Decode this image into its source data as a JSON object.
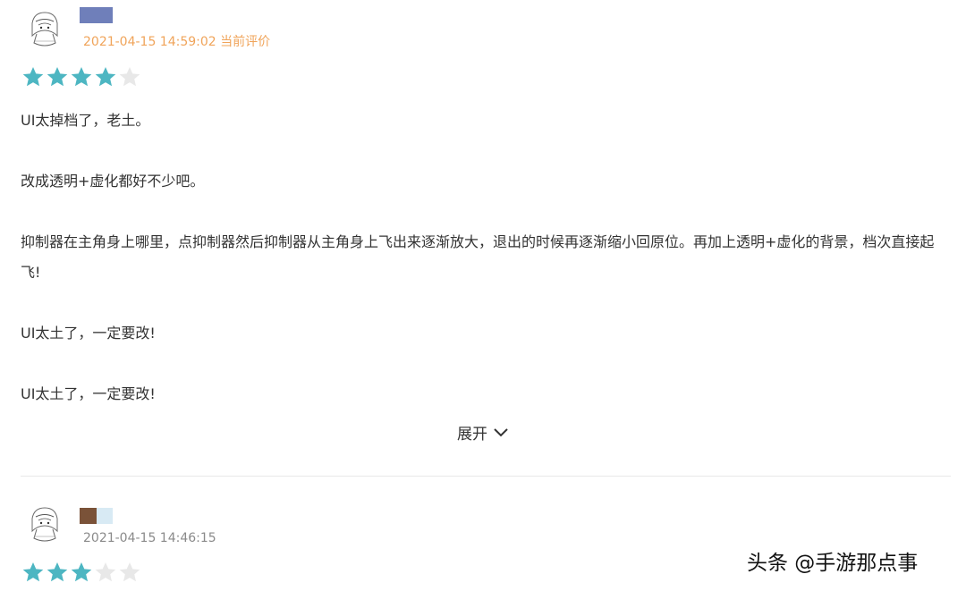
{
  "reviews": [
    {
      "meta": "2021-04-15 14:59:02 当前评价",
      "rating": 4,
      "max_rating": 5,
      "paragraphs": [
        "UI太掉档了，老土。",
        "改成透明+虚化都好不少吧。",
        "抑制器在主角身上哪里，点抑制器然后抑制器从主角身上飞出来逐渐放大，退出的时候再逐渐缩小回原位。再加上透明+虚化的背景，档次直接起飞!",
        "UI太土了，一定要改!",
        "UI太土了，一定要改!"
      ],
      "expand_label": "展开",
      "username_colors": [
        "#6f7fba"
      ]
    },
    {
      "meta": "2021-04-15 14:46:15",
      "rating": 3,
      "max_rating": 5,
      "username_colors": [
        "#7a5238",
        "#d8eaf4"
      ]
    }
  ],
  "watermark": "头条 @手游那点事",
  "colors": {
    "star_filled": "#4db6c2",
    "star_empty": "#e8e8e8",
    "current_meta": "#f0a45a",
    "meta": "#8a8a8a"
  },
  "icons": {
    "star": "star-icon",
    "expand": "chevron-down-icon",
    "avatar": "avatar-icon"
  }
}
